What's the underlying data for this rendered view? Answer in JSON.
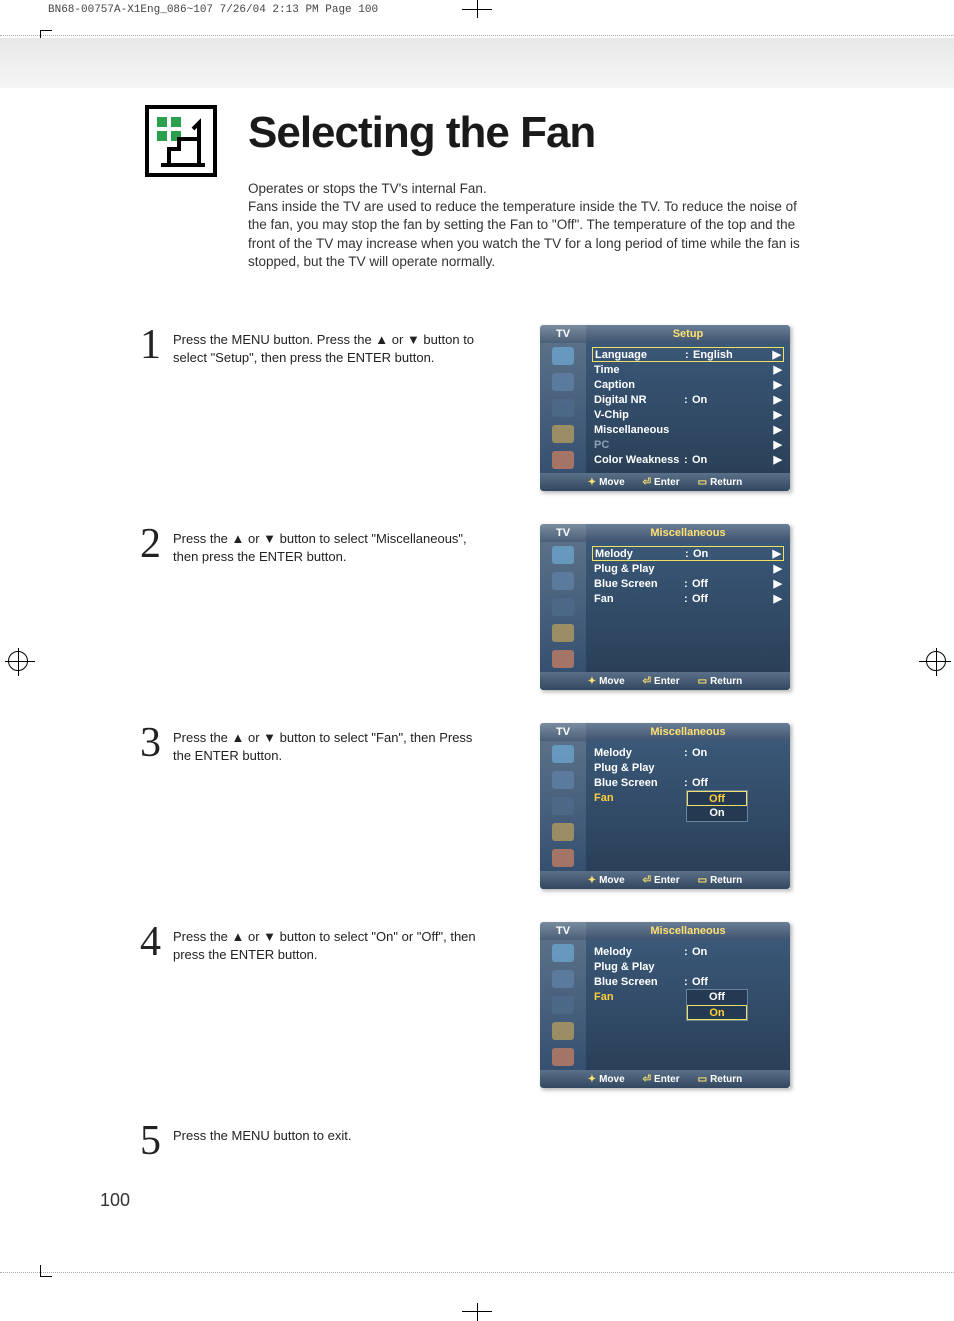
{
  "print_header": "BN68-00757A-X1Eng_086~107  7/26/04  2:13 PM  Page 100",
  "page_number": "100",
  "title": "Selecting the Fan",
  "subtitle": "Operates or stops the TV's internal Fan.",
  "description": "Fans inside the TV are used to reduce the temperature inside the TV. To reduce the noise of the fan, you may stop the fan by setting the Fan to \"Off\". The temperature of the top and the front of the TV may increase when you watch the TV for a long period of time while the fan is stopped, but the TV will operate normally.",
  "steps": {
    "s1": {
      "num": "1",
      "text": "Press the MENU button. Press the ▲ or ▼ button to select \"Setup\", then press the ENTER button."
    },
    "s2": {
      "num": "2",
      "text": "Press the ▲ or ▼ button to select \"Miscellaneous\", then press the ENTER button."
    },
    "s3": {
      "num": "3",
      "text": "Press the ▲ or ▼ button to select \"Fan\", then Press the ENTER button."
    },
    "s4": {
      "num": "4",
      "text": "Press the ▲ or ▼ button to select \"On\" or \"Off\", then press the ENTER button."
    },
    "s5": {
      "num": "5",
      "text": "Press the MENU button to exit."
    }
  },
  "osd_common": {
    "tv": "TV",
    "footer_move": "Move",
    "footer_enter": "Enter",
    "footer_return": "Return"
  },
  "osd1": {
    "title": "Setup",
    "rows": [
      {
        "label": "Language",
        "val": "English",
        "arrow": "▶",
        "sel": true
      },
      {
        "label": "Time",
        "val": "",
        "arrow": "▶"
      },
      {
        "label": "Caption",
        "val": "",
        "arrow": "▶"
      },
      {
        "label": "Digital NR",
        "val": "On",
        "arrow": "▶"
      },
      {
        "label": "V-Chip",
        "val": "",
        "arrow": "▶"
      },
      {
        "label": "Miscellaneous",
        "val": "",
        "arrow": "▶"
      },
      {
        "label": "PC",
        "val": "",
        "arrow": "▶",
        "dim": true
      },
      {
        "label": "Color Weakness",
        "val": "On",
        "arrow": "▶"
      }
    ]
  },
  "osd2": {
    "title": "Miscellaneous",
    "rows": [
      {
        "label": "Melody",
        "val": "On",
        "arrow": "▶",
        "sel": true
      },
      {
        "label": "Plug & Play",
        "val": "",
        "arrow": "▶"
      },
      {
        "label": "Blue Screen",
        "val": "Off",
        "arrow": "▶"
      },
      {
        "label": "Fan",
        "val": "Off",
        "arrow": "▶"
      }
    ]
  },
  "osd3": {
    "title": "Miscellaneous",
    "rows": [
      {
        "label": "Melody",
        "val": "On"
      },
      {
        "label": "Plug & Play",
        "val": ""
      },
      {
        "label": "Blue Screen",
        "val": "Off"
      },
      {
        "label": "Fan",
        "val": "",
        "hl": true
      }
    ],
    "dropdown": {
      "opts": [
        "Off",
        "On"
      ],
      "sel": 0
    }
  },
  "osd4": {
    "title": "Miscellaneous",
    "rows": [
      {
        "label": "Melody",
        "val": "On"
      },
      {
        "label": "Plug & Play",
        "val": ""
      },
      {
        "label": "Blue Screen",
        "val": "Off"
      },
      {
        "label": "Fan",
        "val": "",
        "hl": true
      }
    ],
    "dropdown": {
      "opts": [
        "Off",
        "On"
      ],
      "sel": 1
    }
  }
}
